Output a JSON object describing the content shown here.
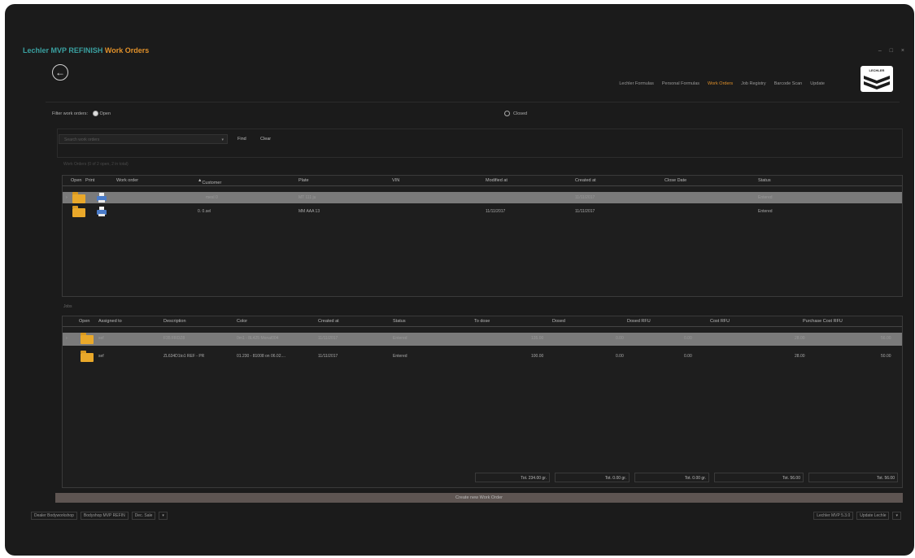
{
  "window": {
    "title_app": "Lechler MVP REFINISH",
    "title_page": "Work Orders",
    "controls": "– □ ×"
  },
  "nav": {
    "back": "←",
    "items": [
      "Lechler Formulas",
      "Personal Formulas",
      "Work Orders",
      "Job Registry",
      "Barcode Scan",
      "Update"
    ],
    "active_index": 2
  },
  "logo_text": "LECHLER",
  "filter": {
    "label": "Filter work orders:",
    "open": "Open",
    "closed": "Closed",
    "open_selected": true
  },
  "search": {
    "placeholder": "Search work orders",
    "find": "Find",
    "clear": "Clear"
  },
  "work_orders": {
    "count_text": "Work Orders (0 of 2 open, 2 in total)",
    "columns": [
      "Open",
      "Print",
      "Work order",
      "Customer",
      "Plate",
      "VIN",
      "Modified at",
      "Created at",
      "Close Date",
      "Status"
    ],
    "rows": [
      {
        "expand": "›",
        "work_order": "",
        "customer": "mesl 0",
        "plate": "MT 111 ju",
        "vin": "",
        "modified": "",
        "created": "11/11/2017",
        "close": "",
        "status": "Entered"
      },
      {
        "expand": "",
        "work_order": "",
        "customer": "0. 0.sel",
        "plate": "MM AAA 13",
        "vin": "",
        "modified": "11/11/2017",
        "created": "11/11/2017",
        "close": "",
        "status": "Entered"
      }
    ]
  },
  "jobs": {
    "label": "Jobs",
    "columns": [
      "Open",
      "Assigned to",
      "Description",
      "Color",
      "Created at",
      "Status",
      "To dose",
      "Dosed",
      "Dosed RFU",
      "Cost RFU",
      "Purchase Cost RFU"
    ],
    "rows": [
      {
        "expand": "›",
        "assigned": "sef",
        "description": "F35 FRDZ8",
        "color": "0m1 - 8L425 Monal004",
        "created": "11/11/2017",
        "status": "Entered",
        "to_dose": "135.00",
        "dosed": "0.00",
        "dosed_rfu": "0.00",
        "cost_rfu": "28.00",
        "purchase": "56.00"
      },
      {
        "expand": "",
        "assigned": "sef",
        "description": "ZL634D1to1 REF - PR",
        "color": "01.230 - 81008 on 06.02....",
        "created": "11/11/2017",
        "status": "Entered",
        "to_dose": "100.00",
        "dosed": "0.00",
        "dosed_rfu": "0.00",
        "cost_rfu": "28.00",
        "purchase": "50.00"
      }
    ],
    "totals": [
      "Tot. 234.00 gr.",
      "Tot. 0.00 gr.",
      "Tot. 0.00 gr.",
      "Tot. 56.00",
      "Tot. 56.00"
    ]
  },
  "create_button": "Create new Work Order",
  "status_bar": {
    "left": [
      "Dealer Bodyworkshop",
      "Bodyshop MVP REFIN",
      "Dec. Sale"
    ],
    "left_dropdown": "▾",
    "right": [
      "Lechler MVP 5.3.0",
      "Update Lechle"
    ],
    "right_dropdown": "▾"
  },
  "colors": {
    "background": "#1b1b1b",
    "accent_orange": "#e0902a",
    "accent_teal": "#3aa0a0",
    "selected_row": "#7a7a7a",
    "create_bar": "#5e5552"
  }
}
